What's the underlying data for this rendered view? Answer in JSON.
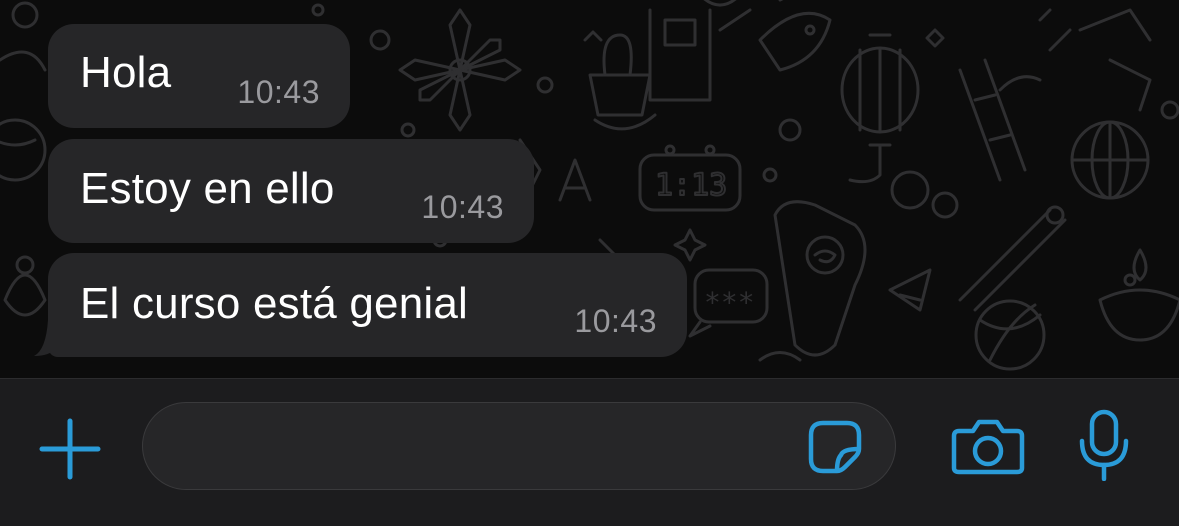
{
  "theme": {
    "accent": "#2a9bd8",
    "bubble_bg": "#262628",
    "time_color": "#9a9a9e"
  },
  "messages": [
    {
      "text": "Hola",
      "time": "10:43"
    },
    {
      "text": "Estoy en ello",
      "time": "10:43"
    },
    {
      "text": "El curso está genial",
      "time": "10:43"
    }
  ],
  "wallpaper_clock": "1:13",
  "wallpaper_password": "***",
  "input_bar": {
    "plus_icon": "plus-icon",
    "message_placeholder": "",
    "sticker_icon": "sticker-icon",
    "camera_icon": "camera-icon",
    "mic_icon": "microphone-icon"
  }
}
